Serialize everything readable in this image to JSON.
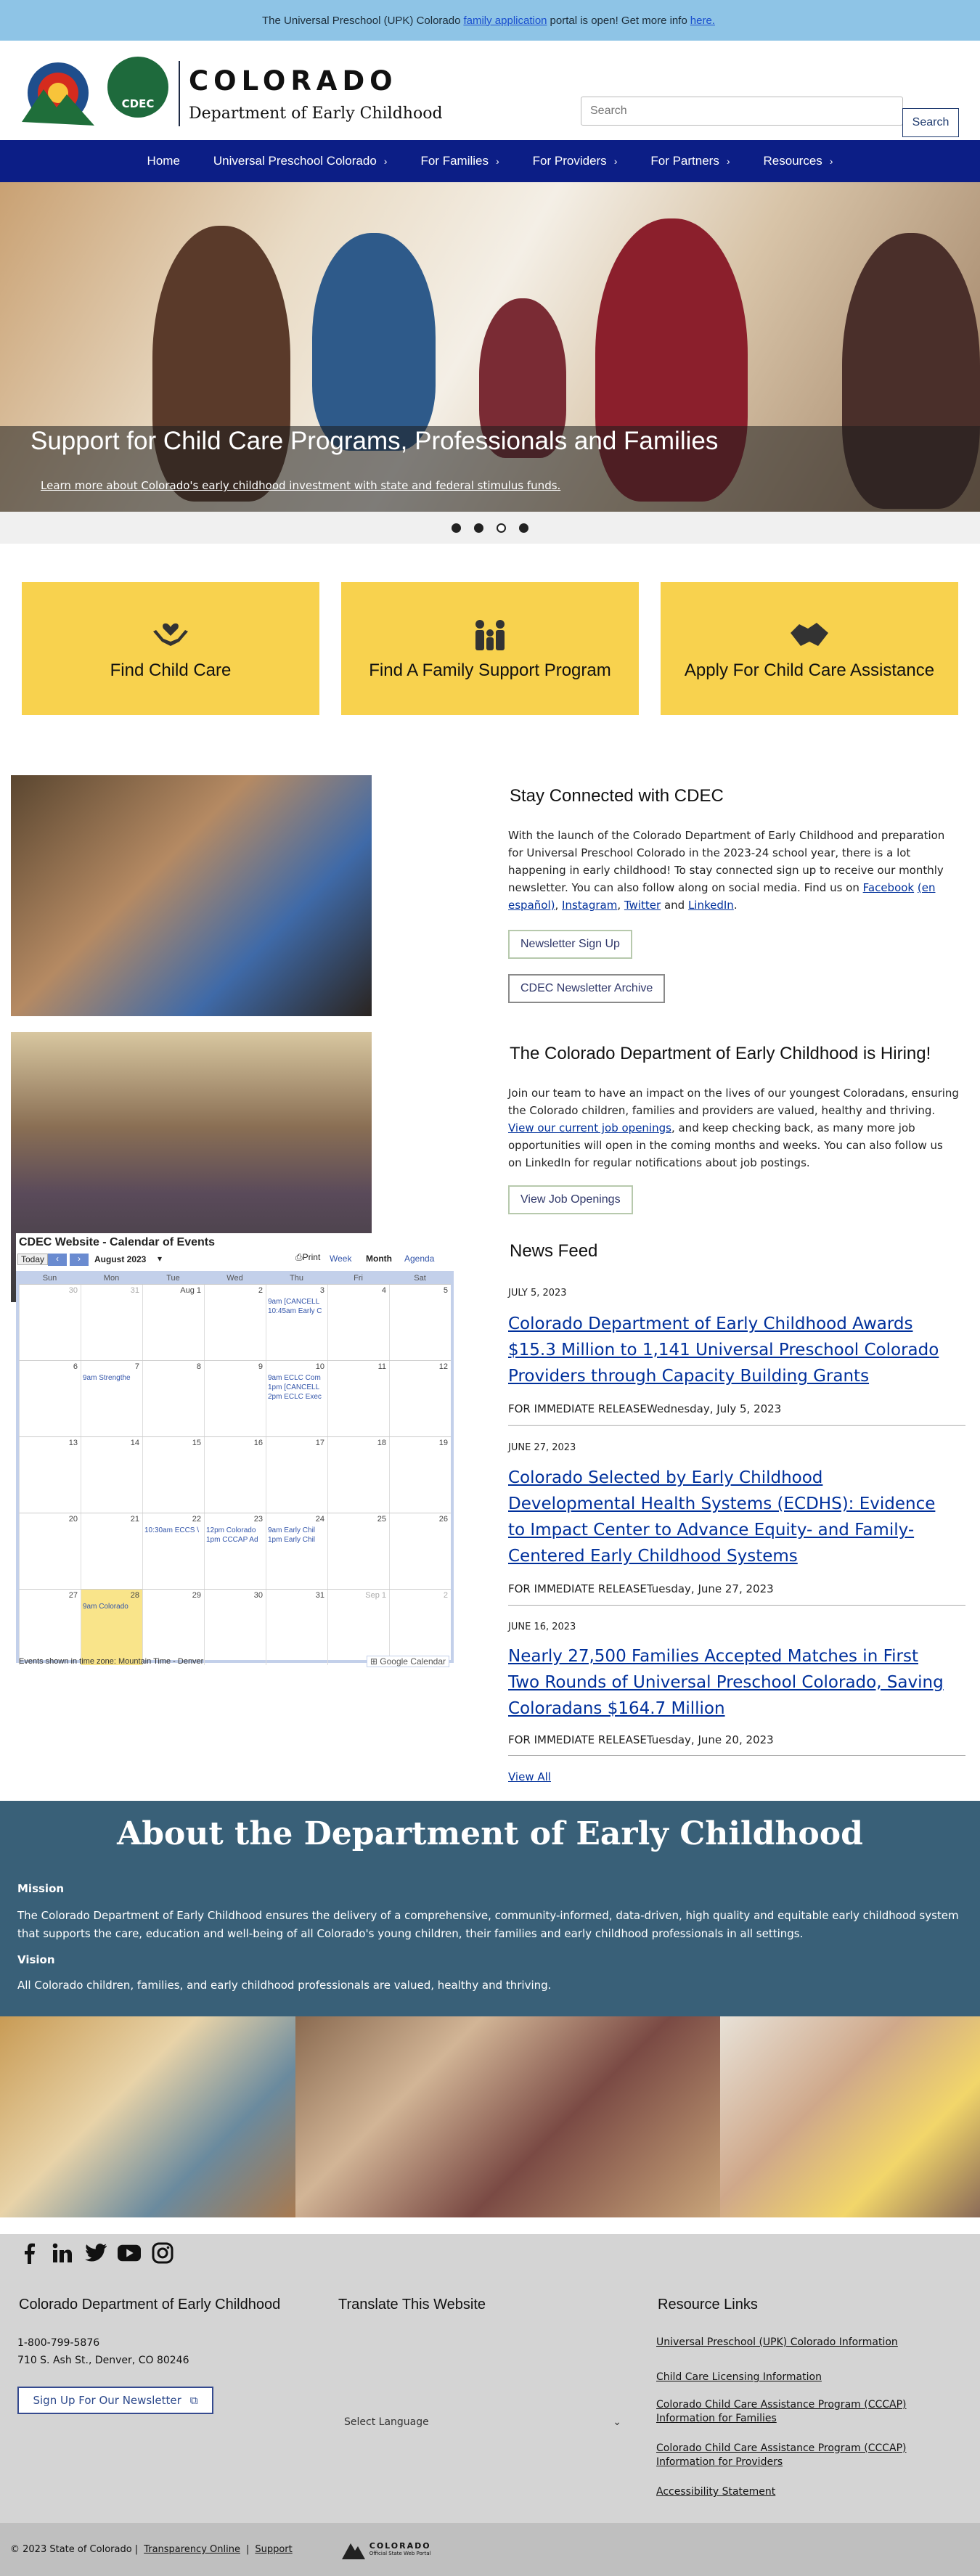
{
  "alert": {
    "prefix": "The Universal Preschool (UPK) Colorado",
    "link1": "family application",
    "middle": "portal is open! Get more info",
    "link2": "here."
  },
  "header": {
    "title": "COLORADO",
    "subtitle": "Department of Early Childhood",
    "seal": "CDEC",
    "search_placeholder": "Search",
    "search_button": "Search"
  },
  "nav": [
    {
      "label": "Home",
      "chevron": ""
    },
    {
      "label": "Universal Preschool Colorado",
      "chevron": "›"
    },
    {
      "label": "For Families",
      "chevron": "›"
    },
    {
      "label": "For Providers",
      "chevron": "›"
    },
    {
      "label": "For Partners",
      "chevron": "›"
    },
    {
      "label": "Resources",
      "chevron": "›"
    }
  ],
  "hero": {
    "heading": "Support for Child Care Programs, Professionals and Families",
    "link": "Learn more about Colorado's early childhood investment with state and federal stimulus funds."
  },
  "cards": [
    {
      "label": "Find Child Care",
      "icon": "hands-heart-icon"
    },
    {
      "label": "Find A Family Support Program",
      "icon": "family-icon"
    },
    {
      "label": "Apply For Child Care Assistance",
      "icon": "handshake-icon"
    }
  ],
  "stay": {
    "title": "Stay Connected with CDEC",
    "body": "With the launch of the Colorado Department of Early Childhood and preparation for Universal Preschool Colorado in the 2023-24 school year, there is a lot happening in early childhood! To stay connected sign up to receive our monthly newsletter. You can also follow along on social media. Find us on",
    "links": [
      "Facebook",
      "(en español)",
      "Instagram",
      "Twitter",
      "LinkedIn"
    ],
    "and": "and",
    "btn1": "Newsletter Sign Up",
    "btn2": "CDEC Newsletter Archive"
  },
  "hiring": {
    "title": "The Colorado Department of Early Childhood is Hiring!",
    "body1": "Join our team to have an impact on the lives of our youngest Coloradans, ensuring the Colorado children, families and providers are valued, healthy and thriving.",
    "link": "View our current job openings",
    "body2": ", and keep checking back, as many more job opportunities will open in the coming months and weeks. You can also follow us on LinkedIn for regular notifications about job postings.",
    "btn": "View Job Openings"
  },
  "calendar": {
    "title": "CDEC Website - Calendar of Events",
    "today": "Today",
    "month": "August 2023",
    "print": "Print",
    "views": [
      "Week",
      "Month",
      "Agenda"
    ],
    "days": [
      "Sun",
      "Mon",
      "Tue",
      "Wed",
      "Thu",
      "Fri",
      "Sat"
    ],
    "weeks": [
      [
        "30",
        "31",
        "Aug 1",
        "2",
        "3",
        "4",
        "5"
      ],
      [
        "6",
        "7",
        "8",
        "9",
        "10",
        "11",
        "12"
      ],
      [
        "13",
        "14",
        "15",
        "16",
        "17",
        "18",
        "19"
      ],
      [
        "20",
        "21",
        "22",
        "23",
        "24",
        "25",
        "26"
      ],
      [
        "27",
        "28",
        "29",
        "30",
        "31",
        "Sep 1",
        "2"
      ]
    ],
    "events": [
      {
        "week": 0,
        "day": 4,
        "line": 0,
        "text": "9am [CANCELL"
      },
      {
        "week": 0,
        "day": 4,
        "line": 1,
        "text": "10:45am Early C"
      },
      {
        "week": 1,
        "day": 1,
        "line": 0,
        "text": "9am Strengthe"
      },
      {
        "week": 1,
        "day": 4,
        "line": 0,
        "text": "9am ECLC Com"
      },
      {
        "week": 1,
        "day": 4,
        "line": 1,
        "text": "1pm [CANCELL"
      },
      {
        "week": 1,
        "day": 4,
        "line": 2,
        "text": "2pm ECLC Exec"
      },
      {
        "week": 3,
        "day": 2,
        "line": 0,
        "text": "10:30am ECCS \\"
      },
      {
        "week": 3,
        "day": 3,
        "line": 0,
        "text": "12pm Colorado"
      },
      {
        "week": 3,
        "day": 3,
        "line": 1,
        "text": "1pm CCCAP Ad"
      },
      {
        "week": 3,
        "day": 4,
        "line": 0,
        "text": "9am Early Chil"
      },
      {
        "week": 3,
        "day": 4,
        "line": 1,
        "text": "1pm Early Chil"
      },
      {
        "week": 4,
        "day": 1,
        "line": 0,
        "text": "9am Colorado"
      }
    ],
    "footer": "Events shown in time zone: Mountain Time - Denver",
    "gcal": "Google Calendar"
  },
  "news": {
    "title": "News Feed",
    "items": [
      {
        "date": "JULY 5, 2023",
        "title": "Colorado Department of Early Childhood Awards $15.3 Million to 1,141 Universal Preschool Colorado Providers through Capacity Building Grants",
        "release": "FOR IMMEDIATE RELEASEWednesday, July 5, 2023"
      },
      {
        "date": "JUNE 27, 2023",
        "title": "Colorado Selected by Early Childhood Developmental Health Systems (ECDHS): Evidence to Impact Center to Advance Equity- and Family-Centered Early Childhood Systems",
        "release": "FOR IMMEDIATE RELEASETuesday, June 27, 2023"
      },
      {
        "date": "JUNE 16, 2023",
        "title": "Nearly 27,500 Families Accepted Matches in First Two Rounds of Universal Preschool Colorado, Saving Coloradans $164.7 Million",
        "release": "FOR IMMEDIATE RELEASETuesday, June 20, 2023"
      }
    ],
    "view_all": "View All"
  },
  "about": {
    "title": "About the Department of Early Childhood",
    "mission_label": "Mission",
    "mission": "The Colorado Department of Early Childhood ensures the delivery of a comprehensive, community-informed, data-driven, high quality and equitable early childhood system that supports the care, education and well-being of all Colorado's young children, their families and early childhood professionals in all settings.",
    "vision_label": "Vision",
    "vision": "All Colorado children, families, and early childhood professionals are valued, healthy and thriving."
  },
  "footer": {
    "social": [
      "facebook-icon",
      "linkedin-icon",
      "twitter-icon",
      "youtube-icon",
      "instagram-icon"
    ],
    "col1_title": "Colorado Department of Early Childhood",
    "phone": "1-800-799-5876",
    "address": "710 S. Ash St., Denver, CO 80246",
    "newsletter": "Sign Up For Our Newsletter",
    "col2_title": "Translate This Website",
    "language": "Select Language",
    "col3_title": "Resource Links",
    "links": [
      "Universal Preschool (UPK) Colorado Information",
      "Child Care Licensing Information",
      "Colorado Child Care Assistance Program (CCCAP) Information for Families",
      "Colorado Child Care Assistance Program (CCCAP) Information for Providers",
      "Accessibility Statement"
    ],
    "copyright": "© 2023 State of Colorado",
    "bottom_links": [
      "Transparency Online",
      "Support"
    ],
    "state_logo": "COLORADO",
    "state_logo_sub": "Official State Web Portal"
  }
}
